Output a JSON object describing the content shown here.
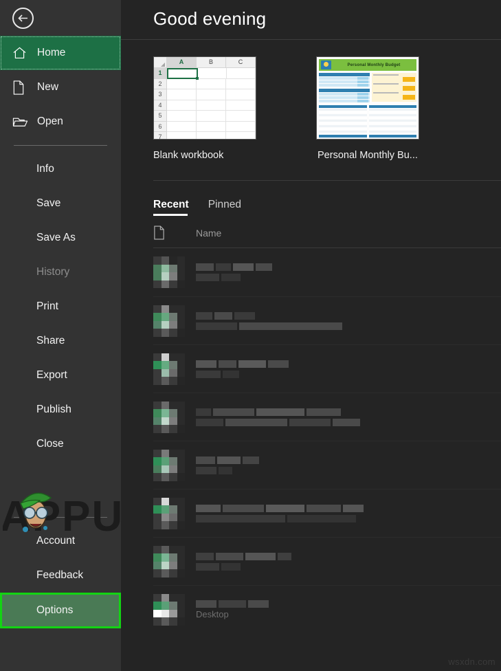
{
  "window": {
    "app": "Excel Backstage",
    "back_label": "Back"
  },
  "sidebar": {
    "top_items": [
      {
        "label": "Home",
        "icon": "home-icon",
        "state": "active"
      },
      {
        "label": "New",
        "icon": "new-document-icon",
        "state": "normal"
      },
      {
        "label": "Open",
        "icon": "open-folder-icon",
        "state": "normal"
      }
    ],
    "mid_items": [
      {
        "label": "Info",
        "state": "normal"
      },
      {
        "label": "Save",
        "state": "normal"
      },
      {
        "label": "Save As",
        "state": "normal"
      },
      {
        "label": "History",
        "state": "disabled"
      },
      {
        "label": "Print",
        "state": "normal"
      },
      {
        "label": "Share",
        "state": "normal"
      },
      {
        "label": "Export",
        "state": "normal"
      },
      {
        "label": "Publish",
        "state": "normal"
      },
      {
        "label": "Close",
        "state": "normal"
      }
    ],
    "bottom_items": [
      {
        "label": "Account",
        "state": "normal"
      },
      {
        "label": "Feedback",
        "state": "normal"
      },
      {
        "label": "Options",
        "state": "annotated"
      }
    ],
    "active_color": "#1d7045",
    "annotation_color": "#13d413",
    "annotation_fill": "#4a7a55",
    "background": "#333333"
  },
  "header": {
    "greeting": "Good evening"
  },
  "templates": {
    "items": [
      {
        "label": "Blank workbook",
        "kind": "blank-workbook"
      },
      {
        "label": "Personal Monthly Bu...",
        "kind": "personal-monthly-budget"
      }
    ],
    "blank_workbook": {
      "columns": [
        "A",
        "B",
        "C"
      ],
      "rows": [
        "1",
        "2",
        "3",
        "4",
        "5",
        "6",
        "7"
      ],
      "selected_cell": "A1"
    },
    "budget": {
      "title": "Personal Monthly Budget",
      "header_color": "#7bbf3f",
      "table_color": "#2e7fb0",
      "accent_color": "#f5b518"
    }
  },
  "recent_panel": {
    "tabs": [
      {
        "label": "Recent",
        "active": true
      },
      {
        "label": "Pinned",
        "active": false
      }
    ],
    "columns": [
      {
        "label": "Name"
      }
    ],
    "rows": [
      {
        "name": "",
        "blurred": true,
        "lines": [
          2,
          1
        ]
      },
      {
        "name": "",
        "blurred": true,
        "lines": [
          2,
          1
        ]
      },
      {
        "name": "",
        "blurred": true,
        "lines": [
          2,
          1
        ]
      },
      {
        "name": "",
        "blurred": true,
        "lines": [
          2,
          2
        ]
      },
      {
        "name": "",
        "blurred": true,
        "lines": [
          1,
          1
        ]
      },
      {
        "name": "",
        "blurred": true,
        "lines": [
          2,
          1
        ]
      },
      {
        "name": "",
        "blurred": true,
        "lines": [
          2,
          1
        ]
      },
      {
        "name": "Desktop",
        "blurred": true,
        "lines": [
          1,
          1
        ]
      }
    ]
  },
  "watermarks": {
    "logo_text": "APPUALS",
    "corner_text": "wsxdn.com"
  }
}
